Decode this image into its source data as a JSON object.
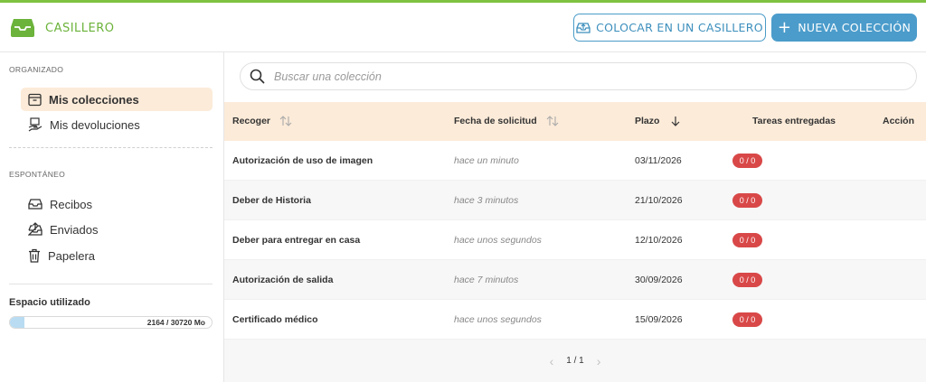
{
  "header": {
    "brand": "CASILLERO",
    "place_button": "COLOCAR EN UN CASILLERO",
    "new_button": "NUEVA COLECCIÓN",
    "accent_color": "#7fc241",
    "primary_color": "#4b9ccb"
  },
  "sidebar": {
    "organized_title": "ORGANIZADO",
    "organized_items": [
      {
        "label": "Mis colecciones",
        "icon": "archive-box-icon",
        "active": true
      },
      {
        "label": "Mis devoluciones",
        "icon": "hand-return-icon",
        "active": false
      }
    ],
    "spontaneous_title": "ESPONTÁNEO",
    "spontaneous_items": [
      {
        "label": "Recibos",
        "icon": "inbox-icon"
      },
      {
        "label": "Enviados",
        "icon": "inbox-sent-icon"
      },
      {
        "label": "Papelera",
        "icon": "trash-icon"
      }
    ],
    "storage": {
      "label": "Espacio utilizado",
      "text": "2164 / 30720 Mo",
      "used": 2164,
      "total": 30720
    }
  },
  "search": {
    "placeholder": "Buscar una colección",
    "value": ""
  },
  "table": {
    "columns": {
      "collect": "Recoger",
      "request_date": "Fecha de solicitud",
      "deadline": "Plazo",
      "tasks": "Tareas entregadas",
      "action": "Acción"
    },
    "rows": [
      {
        "name": "Autorización de uso de imagen",
        "requested": "hace un minuto",
        "deadline": "03/11/2026",
        "tasks": "0 / 0"
      },
      {
        "name": "Deber de Historia",
        "requested": "hace 3 minutos",
        "deadline": "21/10/2026",
        "tasks": "0 / 0"
      },
      {
        "name": "Deber para entregar en casa",
        "requested": "hace unos segundos",
        "deadline": "12/10/2026",
        "tasks": "0 / 0"
      },
      {
        "name": "Autorización de salida",
        "requested": "hace 7 minutos",
        "deadline": "30/09/2026",
        "tasks": "0 / 0"
      },
      {
        "name": "Certificado médico",
        "requested": "hace unos segundos",
        "deadline": "15/09/2026",
        "tasks": "0 / 0"
      }
    ]
  },
  "pagination": {
    "text": "1 / 1",
    "prev": "‹",
    "next": "›"
  }
}
